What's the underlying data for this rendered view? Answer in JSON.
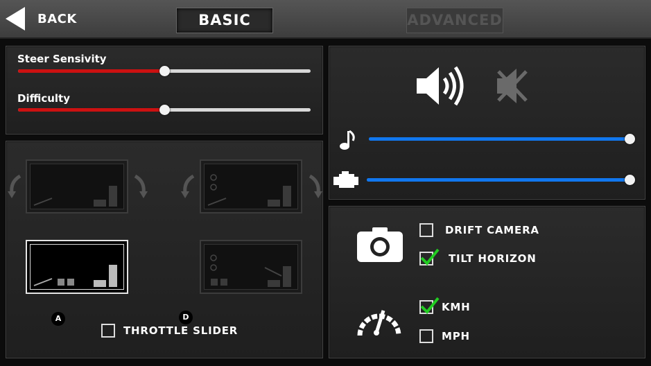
{
  "header": {
    "back_label": "BACK",
    "tabs": [
      {
        "label": "BASIC",
        "active": true
      },
      {
        "label": "ADVANCED",
        "active": false
      }
    ]
  },
  "sliders": [
    {
      "label": "Steer Sensivity",
      "value": 0.5
    },
    {
      "label": "Difficulty",
      "value": 0.5
    }
  ],
  "audio": {
    "sound_on_icon": "speaker-on-icon",
    "sound_off_icon": "speaker-muted-icon",
    "music_volume": 1.0,
    "engine_volume": 1.0
  },
  "controls": {
    "badge_a": "A",
    "badge_d": "D",
    "throttle_slider_label": "THROTTLE SLIDER",
    "throttle_slider_checked": false
  },
  "camera": {
    "drift_camera_label": "DRIFT CAMERA",
    "drift_camera_checked": false,
    "tilt_horizon_label": "TILT HORIZON",
    "tilt_horizon_checked": true
  },
  "units": {
    "kmh_label": "KMH",
    "kmh_checked": true,
    "mph_label": "MPH",
    "mph_checked": false
  },
  "colors": {
    "slider_red": "#cc1111",
    "slider_blue": "#1177ee",
    "check_green": "#22cc22"
  }
}
